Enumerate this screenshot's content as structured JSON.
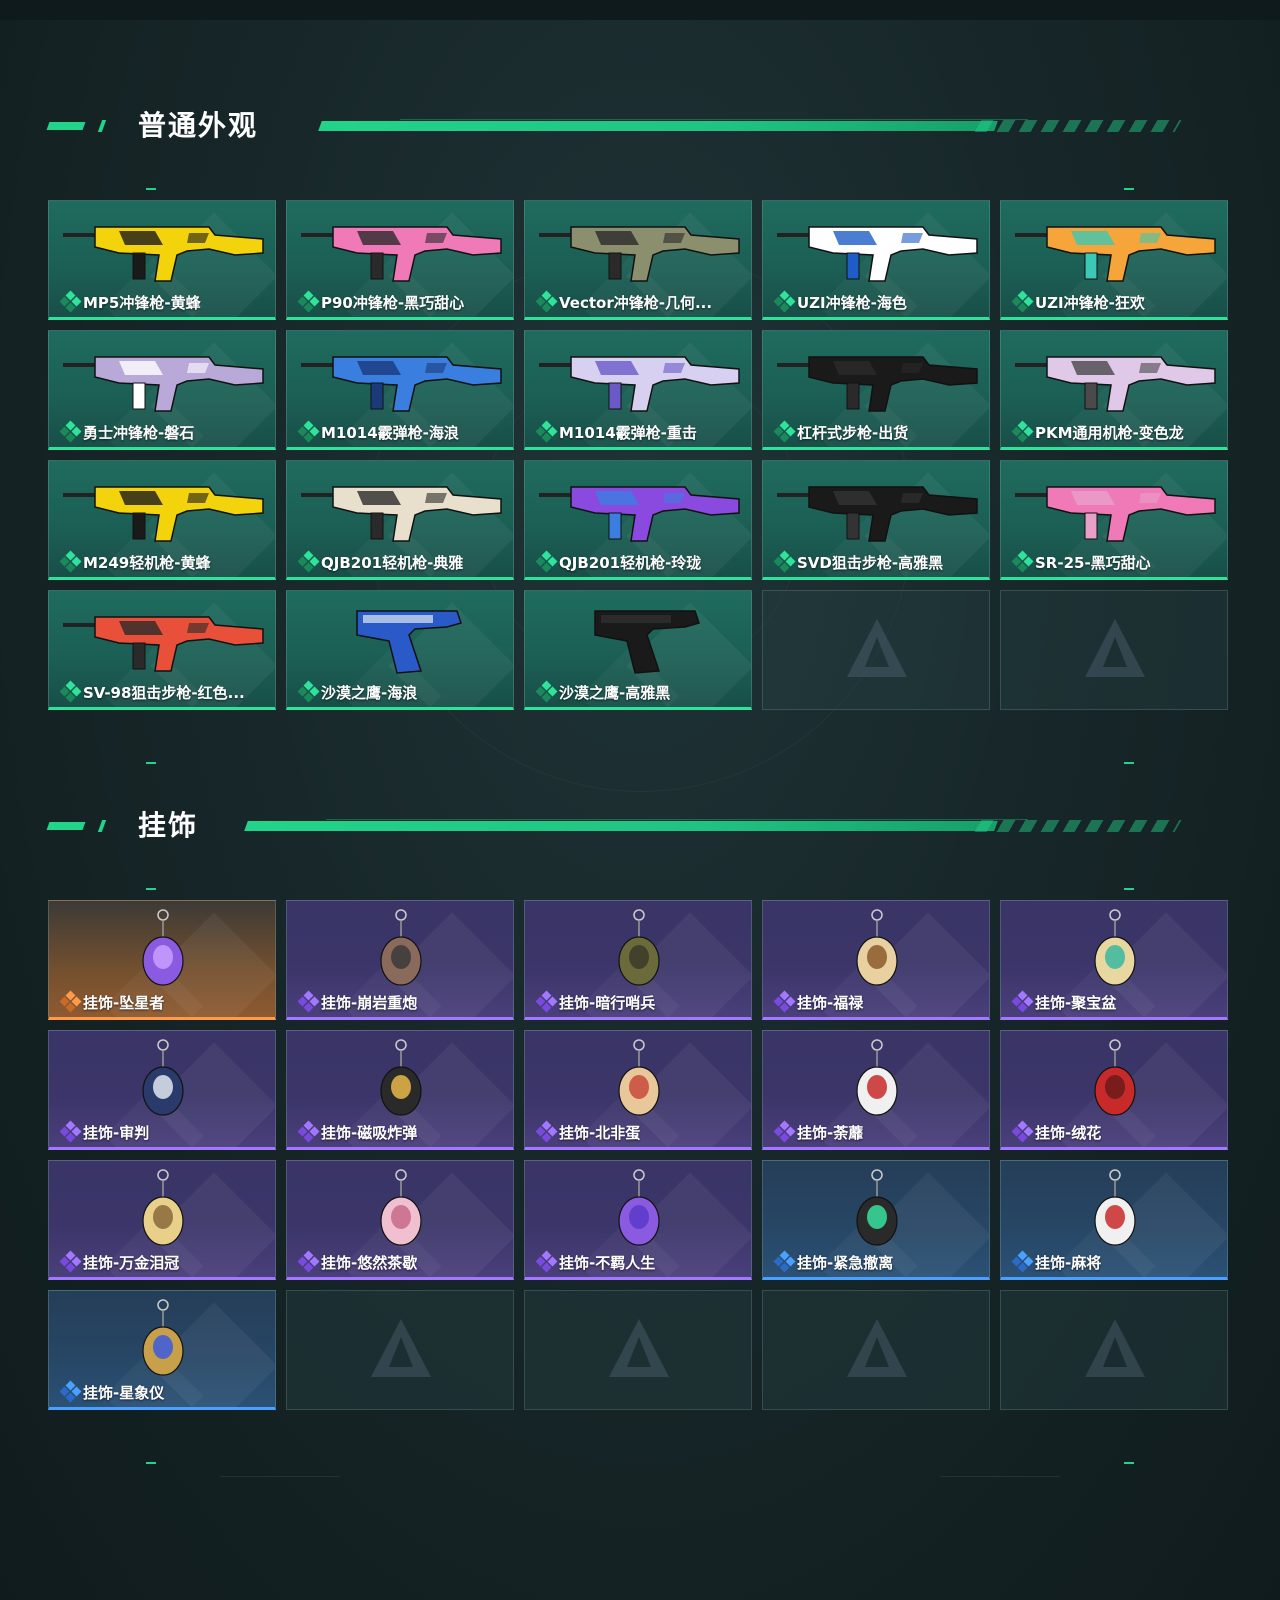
{
  "sections": [
    {
      "title": "普通外观",
      "items": [
        {
          "label": "MP5冲锋枪-黄蜂",
          "rarity": "green",
          "icon": "smg-icon",
          "colors": [
            "#f2d30c",
            "#1a1a1a"
          ]
        },
        {
          "label": "P90冲锋枪-黑巧甜心",
          "rarity": "green",
          "icon": "p90-icon",
          "colors": [
            "#f07ab8",
            "#2a2a2a"
          ]
        },
        {
          "label": "Vector冲锋枪-几何...",
          "rarity": "green",
          "icon": "vector-icon",
          "colors": [
            "#8c8f6e",
            "#2a2a2a"
          ]
        },
        {
          "label": "UZI冲锋枪-海色",
          "rarity": "green",
          "icon": "uzi-icon",
          "colors": [
            "#ffffff",
            "#1e5cc8"
          ]
        },
        {
          "label": "UZI冲锋枪-狂欢",
          "rarity": "green",
          "icon": "uzi-icon",
          "colors": [
            "#f5a53a",
            "#3cc8b4"
          ]
        },
        {
          "label": "勇士冲锋枪-磐石",
          "rarity": "green",
          "icon": "smg-icon",
          "colors": [
            "#b8a9d9",
            "#ffffff"
          ]
        },
        {
          "label": "M1014霰弹枪-海浪",
          "rarity": "green",
          "icon": "shotgun-icon",
          "colors": [
            "#3a7fe0",
            "#1a3a7a"
          ]
        },
        {
          "label": "M1014霰弹枪-重击",
          "rarity": "green",
          "icon": "shotgun-icon",
          "colors": [
            "#d8d0f0",
            "#6a5ac8"
          ]
        },
        {
          "label": "杠杆式步枪-出货",
          "rarity": "green",
          "icon": "rifle-icon",
          "colors": [
            "#1a1a1a",
            "#2a2a2a"
          ]
        },
        {
          "label": "PKM通用机枪-变色龙",
          "rarity": "green",
          "icon": "machinegun-icon",
          "colors": [
            "#e0c8e8",
            "#4a4a4a"
          ]
        },
        {
          "label": "M249轻机枪-黄蜂",
          "rarity": "green",
          "icon": "machinegun-icon",
          "colors": [
            "#f2d30c",
            "#1a1a1a"
          ]
        },
        {
          "label": "QJB201轻机枪-典雅",
          "rarity": "green",
          "icon": "machinegun-icon",
          "colors": [
            "#e8e0cc",
            "#2a2a2a"
          ]
        },
        {
          "label": "QJB201轻机枪-玲珑",
          "rarity": "green",
          "icon": "machinegun-icon",
          "colors": [
            "#8a4ae0",
            "#3a7fe0"
          ]
        },
        {
          "label": "SVD狙击步枪-高雅黑",
          "rarity": "green",
          "icon": "sniper-icon",
          "colors": [
            "#1a1a1a",
            "#333333"
          ]
        },
        {
          "label": "SR-25-黑巧甜心",
          "rarity": "green",
          "icon": "rifle-icon",
          "colors": [
            "#f07ab8",
            "#e8a0c8"
          ]
        },
        {
          "label": "SV-98狙击步枪-红色...",
          "rarity": "green",
          "icon": "sniper-icon",
          "colors": [
            "#e8503a",
            "#2a2a2a"
          ]
        },
        {
          "label": "沙漠之鹰-海浪",
          "rarity": "green",
          "icon": "pistol-icon",
          "colors": [
            "#2a5ac8",
            "#e0e8f0"
          ]
        },
        {
          "label": "沙漠之鹰-高雅黑",
          "rarity": "green",
          "icon": "pistol-icon",
          "colors": [
            "#1a1a1a",
            "#333333"
          ]
        },
        {
          "label": "",
          "rarity": "empty"
        },
        {
          "label": "",
          "rarity": "empty"
        }
      ]
    },
    {
      "title": "挂饰",
      "items": [
        {
          "label": "挂饰-坠星者",
          "rarity": "orange",
          "icon": "crystal-charm-icon",
          "colors": [
            "#8a5ae0",
            "#c8a0ff"
          ]
        },
        {
          "label": "挂饰-崩岩重炮",
          "rarity": "purple",
          "icon": "figure-charm-icon",
          "colors": [
            "#8a6a5a",
            "#3a3a3a"
          ]
        },
        {
          "label": "挂饰-暗行哨兵",
          "rarity": "purple",
          "icon": "figure-charm-icon",
          "colors": [
            "#6a6a3a",
            "#3a3a2a"
          ]
        },
        {
          "label": "挂饰-福禄",
          "rarity": "purple",
          "icon": "gourd-charm-icon",
          "colors": [
            "#e8d0a0",
            "#8a5a2a"
          ]
        },
        {
          "label": "挂饰-聚宝盆",
          "rarity": "purple",
          "icon": "bowl-charm-icon",
          "colors": [
            "#e8d8a0",
            "#3ab8a0"
          ]
        },
        {
          "label": "挂饰-审判",
          "rarity": "purple",
          "icon": "card-charm-icon",
          "colors": [
            "#2a3a6a",
            "#e0e8f0"
          ]
        },
        {
          "label": "挂饰-磁吸炸弹",
          "rarity": "purple",
          "icon": "bomb-charm-icon",
          "colors": [
            "#2a2a2a",
            "#e8b84a"
          ]
        },
        {
          "label": "挂饰-北非蛋",
          "rarity": "purple",
          "icon": "food-charm-icon",
          "colors": [
            "#e8c89a",
            "#c84a3a"
          ]
        },
        {
          "label": "挂饰-荼蘼",
          "rarity": "purple",
          "icon": "flower-charm-icon",
          "colors": [
            "#f0f0f0",
            "#c82a2a"
          ]
        },
        {
          "label": "挂饰-绒花",
          "rarity": "purple",
          "icon": "flower-charm-icon",
          "colors": [
            "#c82a2a",
            "#6a1a1a"
          ]
        },
        {
          "label": "挂饰-万金泪冠",
          "rarity": "purple",
          "icon": "burger-charm-icon",
          "colors": [
            "#e8d08a",
            "#8a6a3a"
          ]
        },
        {
          "label": "挂饰-悠然茶歇",
          "rarity": "purple",
          "icon": "cupcake-charm-icon",
          "colors": [
            "#f0c0d0",
            "#c86a8a"
          ]
        },
        {
          "label": "挂饰-不羁人生",
          "rarity": "purple",
          "icon": "shoe-charm-icon",
          "colors": [
            "#8a5ae0",
            "#5a3ac8"
          ]
        },
        {
          "label": "挂饰-紧急撤离",
          "rarity": "blue",
          "icon": "sign-charm-icon",
          "colors": [
            "#2a2a2a",
            "#3ae0a0"
          ]
        },
        {
          "label": "挂饰-麻将",
          "rarity": "blue",
          "icon": "mahjong-charm-icon",
          "colors": [
            "#f0f0f0",
            "#c82a2a"
          ]
        },
        {
          "label": "挂饰-星象仪",
          "rarity": "blue",
          "icon": "astrolabe-charm-icon",
          "colors": [
            "#c8a04a",
            "#3a5ae0"
          ]
        },
        {
          "label": "",
          "rarity": "empty"
        },
        {
          "label": "",
          "rarity": "empty"
        },
        {
          "label": "",
          "rarity": "empty"
        },
        {
          "label": "",
          "rarity": "empty"
        }
      ]
    }
  ],
  "theme": {
    "accent": "#22d48a",
    "green_border": "#2fe39a",
    "purple_border": "#a178ff",
    "blue_border": "#4aa0ff",
    "orange_border": "#ff9a48"
  }
}
